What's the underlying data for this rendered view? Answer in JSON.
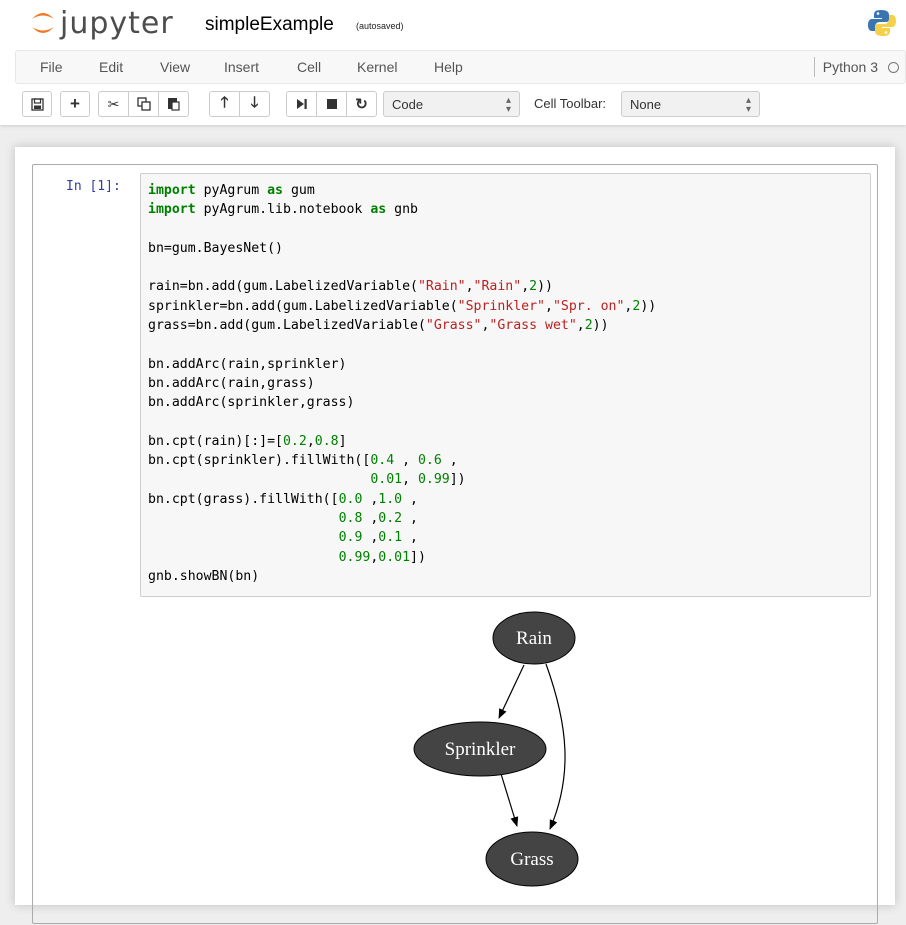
{
  "header": {
    "logo_text": "jupyter",
    "notebook_name": "simpleExample",
    "autosave_status": "(autosaved)"
  },
  "menu": {
    "items": [
      "File",
      "Edit",
      "View",
      "Insert",
      "Cell",
      "Kernel",
      "Help"
    ],
    "kernel_name": "Python 3"
  },
  "toolbar": {
    "cell_type": "Code",
    "cell_toolbar_label": "Cell Toolbar:",
    "cell_toolbar_value": "None"
  },
  "cell": {
    "prompt": "In [1]:",
    "code_lines": [
      [
        [
          "kw",
          "import"
        ],
        [
          "t",
          " pyAgrum "
        ],
        [
          "kw",
          "as"
        ],
        [
          "t",
          " gum"
        ]
      ],
      [
        [
          "kw",
          "import"
        ],
        [
          "t",
          " pyAgrum.lib.notebook "
        ],
        [
          "kw",
          "as"
        ],
        [
          "t",
          " gnb"
        ]
      ],
      [],
      [
        [
          "t",
          "bn=gum.BayesNet()"
        ]
      ],
      [],
      [
        [
          "t",
          "rain=bn.add(gum.LabelizedVariable("
        ],
        [
          "st",
          "\"Rain\""
        ],
        [
          "t",
          ","
        ],
        [
          "st",
          "\"Rain\""
        ],
        [
          "t",
          ","
        ],
        [
          "nu",
          "2"
        ],
        [
          "t",
          "))"
        ]
      ],
      [
        [
          "t",
          "sprinkler=bn.add(gum.LabelizedVariable("
        ],
        [
          "st",
          "\"Sprinkler\""
        ],
        [
          "t",
          ","
        ],
        [
          "st",
          "\"Spr. on\""
        ],
        [
          "t",
          ","
        ],
        [
          "nu",
          "2"
        ],
        [
          "t",
          "))"
        ]
      ],
      [
        [
          "t",
          "grass=bn.add(gum.LabelizedVariable("
        ],
        [
          "st",
          "\"Grass\""
        ],
        [
          "t",
          ","
        ],
        [
          "st",
          "\"Grass wet\""
        ],
        [
          "t",
          ","
        ],
        [
          "nu",
          "2"
        ],
        [
          "t",
          "))"
        ]
      ],
      [],
      [
        [
          "t",
          "bn.addArc(rain,sprinkler)"
        ]
      ],
      [
        [
          "t",
          "bn.addArc(rain,grass)"
        ]
      ],
      [
        [
          "t",
          "bn.addArc(sprinkler,grass)"
        ]
      ],
      [],
      [
        [
          "t",
          "bn.cpt(rain)[:]=["
        ],
        [
          "nu",
          "0.2"
        ],
        [
          "t",
          ","
        ],
        [
          "nu",
          "0.8"
        ],
        [
          "t",
          "]"
        ]
      ],
      [
        [
          "t",
          "bn.cpt(sprinkler).fillWith(["
        ],
        [
          "nu",
          "0.4"
        ],
        [
          "t",
          " , "
        ],
        [
          "nu",
          "0.6"
        ],
        [
          "t",
          " ,"
        ]
      ],
      [
        [
          "t",
          "                            "
        ],
        [
          "nu",
          "0.01"
        ],
        [
          "t",
          ", "
        ],
        [
          "nu",
          "0.99"
        ],
        [
          "t",
          "])"
        ]
      ],
      [
        [
          "t",
          "bn.cpt(grass).fillWith(["
        ],
        [
          "nu",
          "0.0"
        ],
        [
          "t",
          " ,"
        ],
        [
          "nu",
          "1.0"
        ],
        [
          "t",
          " ,"
        ]
      ],
      [
        [
          "t",
          "                        "
        ],
        [
          "nu",
          "0.8"
        ],
        [
          "t",
          " ,"
        ],
        [
          "nu",
          "0.2"
        ],
        [
          "t",
          " ,"
        ]
      ],
      [
        [
          "t",
          "                        "
        ],
        [
          "nu",
          "0.9"
        ],
        [
          "t",
          " ,"
        ],
        [
          "nu",
          "0.1"
        ],
        [
          "t",
          " ,"
        ]
      ],
      [
        [
          "t",
          "                        "
        ],
        [
          "nu",
          "0.99"
        ],
        [
          "t",
          ","
        ],
        [
          "nu",
          "0.01"
        ],
        [
          "t",
          "])"
        ]
      ],
      [
        [
          "t",
          "gnb.showBN(bn)"
        ]
      ]
    ]
  },
  "graph": {
    "nodes": [
      {
        "id": "rain",
        "label": "Rain"
      },
      {
        "id": "sprinkler",
        "label": "Sprinkler"
      },
      {
        "id": "grass",
        "label": "Grass"
      }
    ],
    "edges": [
      {
        "from": "rain",
        "to": "sprinkler"
      },
      {
        "from": "rain",
        "to": "grass"
      },
      {
        "from": "sprinkler",
        "to": "grass"
      }
    ],
    "node_fill": "#444444",
    "node_text": "#ffffff"
  },
  "colors": {
    "keyword": "#008000",
    "string": "#ba2121",
    "number": "#008000",
    "prompt": "#303f9f"
  }
}
